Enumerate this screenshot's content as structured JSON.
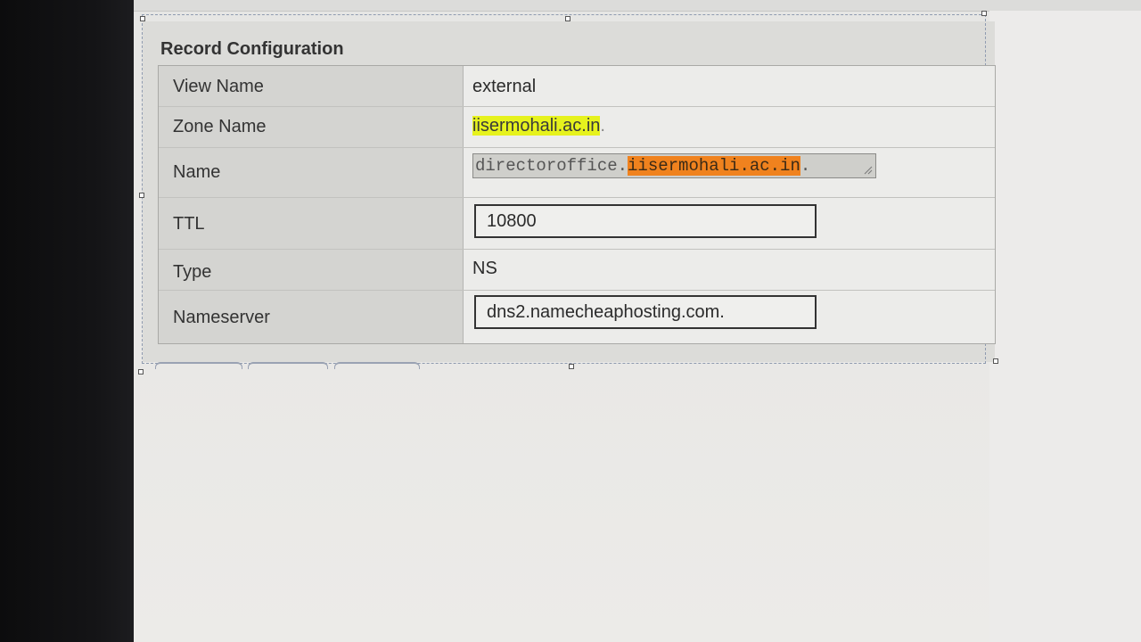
{
  "panel": {
    "title": "Record Configuration"
  },
  "record": {
    "view_name": {
      "label": "View Name",
      "value": "external"
    },
    "zone_name": {
      "label": "Zone Name",
      "value": "iisermohali.ac.in",
      "suffix": "."
    },
    "name": {
      "label": "Name",
      "prefix": "directoroffice.",
      "highlight": "iisermohali.ac.in",
      "suffix": "."
    },
    "ttl": {
      "label": "TTL",
      "value": "10800"
    },
    "type": {
      "label": "Type",
      "value": "NS"
    },
    "nameserver": {
      "label": "Nameserver",
      "value": "dns2.namecheaphosting.com."
    }
  },
  "colors": {
    "zone_highlight": "#e6f21d",
    "name_highlight": "#f0821e"
  },
  "icons": {
    "resize": "resize-grip-icon"
  }
}
